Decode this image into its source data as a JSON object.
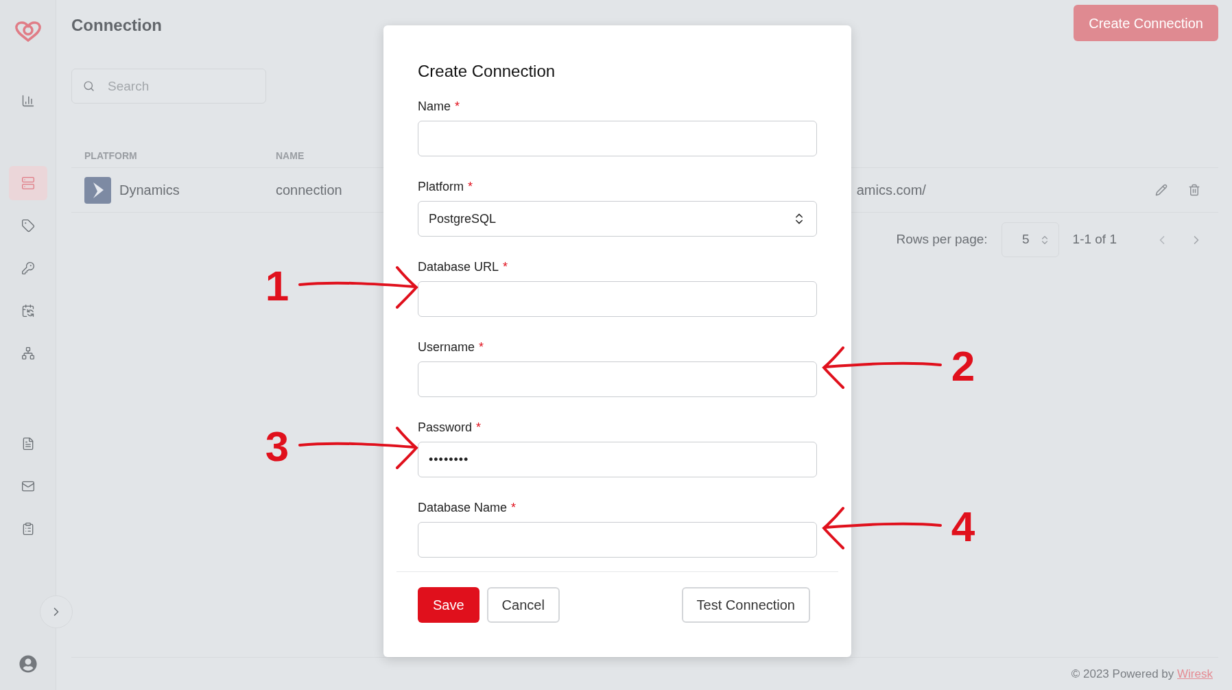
{
  "page": {
    "title": "Connection",
    "create_button": "Create Connection"
  },
  "sidebar": {
    "items": [
      {
        "selected": false
      },
      {
        "selected": true
      },
      {
        "selected": false
      },
      {
        "selected": false
      },
      {
        "selected": false
      },
      {
        "selected": false
      },
      {
        "selected": false
      },
      {
        "selected": false
      },
      {
        "selected": false
      }
    ]
  },
  "search": {
    "placeholder": "Search"
  },
  "table": {
    "columns": [
      "PLATFORM",
      "NAME"
    ],
    "rows": [
      {
        "platform": "Dynamics",
        "name": "connection",
        "column_3": "amics.com/"
      }
    ]
  },
  "pagination": {
    "rows_label": "Rows per page:",
    "rows_value": "5",
    "range": "1-1 of 1"
  },
  "dialog": {
    "title": "Create Connection",
    "fields": [
      {
        "label": "Name",
        "required_mark": "*",
        "kind": "text"
      },
      {
        "label": "Platform",
        "required_mark": "*",
        "kind": "select",
        "value": "PostgreSQL"
      },
      {
        "label": "Database URL",
        "required_mark": "*",
        "kind": "text",
        "annotation": {
          "label": "1",
          "kind": "left"
        }
      },
      {
        "label": "Username",
        "required_mark": "*",
        "kind": "text",
        "annotation": {
          "label": "2",
          "kind": "right"
        }
      },
      {
        "label": "Password",
        "required_mark": "*",
        "kind": "password",
        "value": "••••••••",
        "annotation": {
          "label": "3",
          "kind": "left"
        }
      },
      {
        "label": "Database Name",
        "required_mark": "*",
        "kind": "text",
        "annotation": {
          "label": "4",
          "kind": "right"
        }
      }
    ],
    "buttons": [
      {
        "label": "Save",
        "kind": "primary"
      },
      {
        "label": "Cancel",
        "kind": "outline"
      },
      {
        "label": "Test Connection",
        "kind": "outline"
      }
    ]
  },
  "footer": {
    "text": "© 2023 Powered by ",
    "link": "Wiresk"
  }
}
